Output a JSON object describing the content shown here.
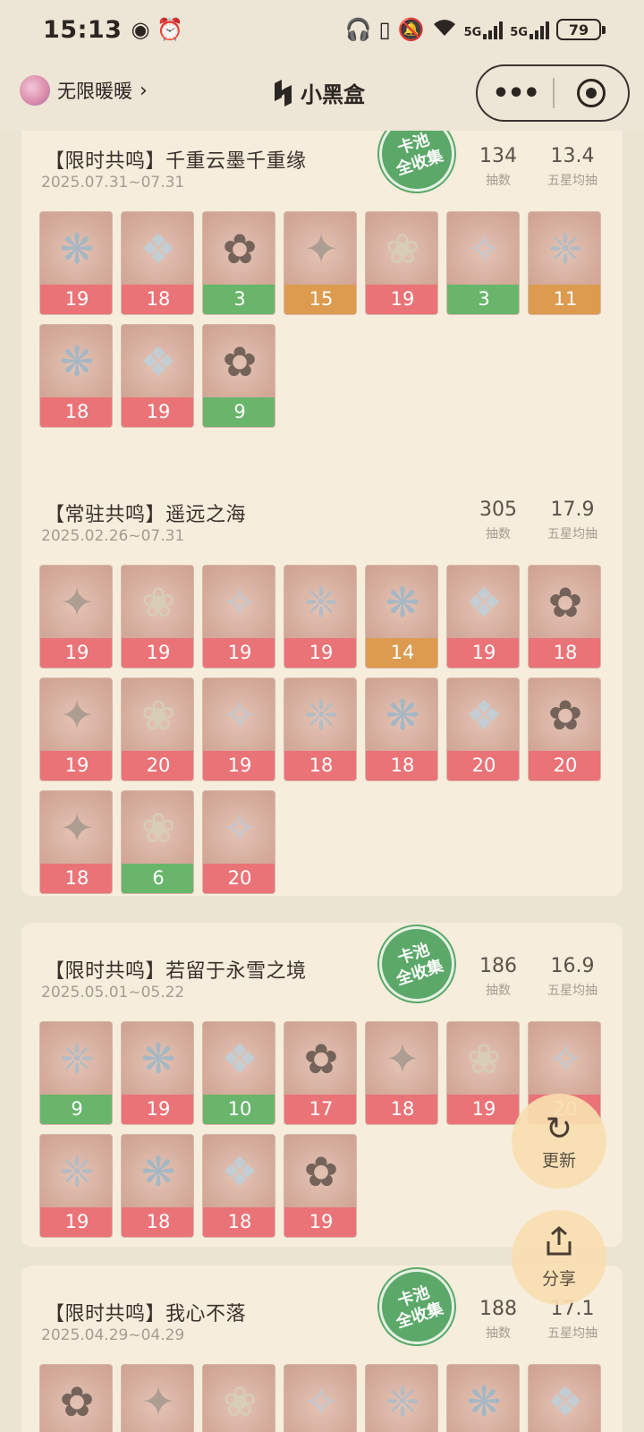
{
  "status": {
    "time": "15:13",
    "battery": "79",
    "network1": "5G",
    "network2": "5G"
  },
  "nav": {
    "username": "无限暖暖",
    "app_title": "小黑盒",
    "more": "•••"
  },
  "cards": [
    {
      "title": "【限时共鸣】千重云墨千重缘",
      "date": "2025.07.31~07.31",
      "stamp": [
        "卡池",
        "全收集"
      ],
      "draws": "134",
      "draws_label": "抽数",
      "avg": "13.4",
      "avg_label": "五星均抽",
      "items": [
        {
          "v": "19",
          "c": "red"
        },
        {
          "v": "18",
          "c": "red"
        },
        {
          "v": "3",
          "c": "green"
        },
        {
          "v": "15",
          "c": "orange"
        },
        {
          "v": "19",
          "c": "red"
        },
        {
          "v": "3",
          "c": "green"
        },
        {
          "v": "11",
          "c": "orange"
        },
        {
          "v": "18",
          "c": "red"
        },
        {
          "v": "19",
          "c": "red"
        },
        {
          "v": "9",
          "c": "green"
        }
      ]
    },
    {
      "title": "【常驻共鸣】遥远之海",
      "date": "2025.02.26~07.31",
      "stamp": null,
      "draws": "305",
      "draws_label": "抽数",
      "avg": "17.9",
      "avg_label": "五星均抽",
      "items": [
        {
          "v": "19",
          "c": "red"
        },
        {
          "v": "19",
          "c": "red"
        },
        {
          "v": "19",
          "c": "red"
        },
        {
          "v": "19",
          "c": "red"
        },
        {
          "v": "14",
          "c": "orange"
        },
        {
          "v": "19",
          "c": "red"
        },
        {
          "v": "18",
          "c": "red"
        },
        {
          "v": "19",
          "c": "red"
        },
        {
          "v": "20",
          "c": "red"
        },
        {
          "v": "19",
          "c": "red"
        },
        {
          "v": "18",
          "c": "red"
        },
        {
          "v": "18",
          "c": "red"
        },
        {
          "v": "20",
          "c": "red"
        },
        {
          "v": "20",
          "c": "red"
        },
        {
          "v": "18",
          "c": "red"
        },
        {
          "v": "6",
          "c": "green"
        },
        {
          "v": "20",
          "c": "red"
        }
      ]
    },
    {
      "title": "【限时共鸣】若留于永雪之境",
      "date": "2025.05.01~05.22",
      "stamp": [
        "卡池",
        "全收集"
      ],
      "draws": "186",
      "draws_label": "抽数",
      "avg": "16.9",
      "avg_label": "五星均抽",
      "items": [
        {
          "v": "9",
          "c": "green"
        },
        {
          "v": "19",
          "c": "red"
        },
        {
          "v": "10",
          "c": "green"
        },
        {
          "v": "17",
          "c": "red"
        },
        {
          "v": "18",
          "c": "red"
        },
        {
          "v": "19",
          "c": "red"
        },
        {
          "v": "20",
          "c": "red"
        },
        {
          "v": "19",
          "c": "red"
        },
        {
          "v": "18",
          "c": "red"
        },
        {
          "v": "18",
          "c": "red"
        },
        {
          "v": "19",
          "c": "red"
        }
      ]
    },
    {
      "title": "【限时共鸣】我心不落",
      "date": "2025.04.29~04.29",
      "stamp": [
        "卡池",
        "全收集"
      ],
      "draws": "188",
      "draws_label": "抽数",
      "avg": "17.1",
      "avg_label": "五星均抽",
      "items": [
        {
          "v": "",
          "c": "red"
        },
        {
          "v": "",
          "c": "red"
        },
        {
          "v": "",
          "c": "red"
        },
        {
          "v": "",
          "c": "red"
        },
        {
          "v": "",
          "c": "red"
        },
        {
          "v": "",
          "c": "orange"
        },
        {
          "v": "",
          "c": "red"
        }
      ]
    }
  ],
  "fab": {
    "refresh_label": "更新",
    "share_label": "分享"
  },
  "colors": {
    "red": "#ea7378",
    "green": "#69b56b",
    "orange": "#dc9b4f",
    "stamp": "#5ba869"
  }
}
